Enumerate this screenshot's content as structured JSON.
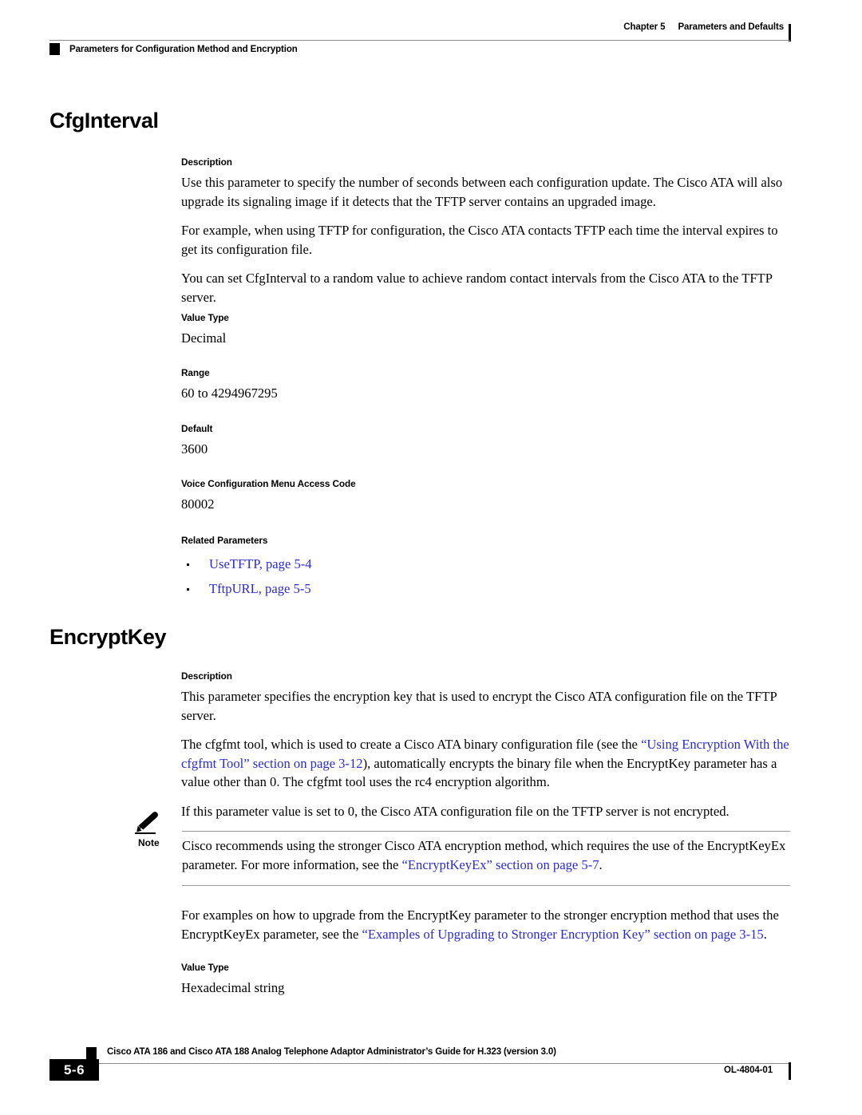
{
  "header": {
    "chapter": "Chapter 5",
    "chapter_title": "Parameters and Defaults",
    "running_head": "Parameters for Configuration Method and Encryption"
  },
  "sections": [
    {
      "title": "CfgInterval",
      "description_label": "Description",
      "description_paragraphs": [
        "Use this parameter to specify the number of seconds between each configuration update. The Cisco ATA will also upgrade its signaling image if it detects that the TFTP server contains an upgraded image.",
        "For example, when using TFTP for configuration, the Cisco ATA contacts TFTP each time the interval expires to get its configuration file.",
        "You can set CfgInterval to a random value to achieve random contact intervals from the Cisco ATA to the TFTP server."
      ],
      "value_type_label": "Value Type",
      "value_type": "Decimal",
      "range_label": "Range",
      "range": "60 to 4294967295",
      "default_label": "Default",
      "default": "3600",
      "access_code_label": "Voice Configuration Menu Access Code",
      "access_code": "80002",
      "related_label": "Related Parameters",
      "related": [
        "UseTFTP, page 5-4",
        "TftpURL, page 5-5"
      ]
    },
    {
      "title": "EncryptKey",
      "description_label": "Description",
      "para1": "This parameter specifies the encryption key that is used to encrypt the Cisco ATA configuration file on the TFTP server.",
      "para2_pre": "The cfgfmt tool, which is used to create a Cisco ATA binary configuration file (see the ",
      "para2_link": "“Using Encryption With the cfgfmt Tool” section on page 3-12",
      "para2_post": "), automatically encrypts the binary file when the EncryptKey parameter has a value other than 0. The cfgfmt tool uses the rc4 encryption algorithm.",
      "para3": "If this parameter value is set to 0, the Cisco ATA configuration file on the TFTP server is not encrypted.",
      "note_word": "Note",
      "note_pre": "Cisco recommends using the stronger Cisco ATA encryption method, which requires the use of the EncryptKeyEx parameter. For more information, see the ",
      "note_link": "“EncryptKeyEx” section on page 5-7",
      "note_post": ".",
      "para4_pre": "For examples on how to upgrade from the EncryptKey parameter to the stronger encryption method that uses the EncryptKeyEx parameter, see the ",
      "para4_link": "“Examples of Upgrading to Stronger Encryption Key” section on page 3-15",
      "para4_post": ".",
      "value_type_label": "Value Type",
      "value_type": "Hexadecimal string"
    }
  ],
  "footer": {
    "guide_title": "Cisco ATA 186 and Cisco ATA 188 Analog Telephone Adaptor Administrator’s Guide for H.323 (version 3.0)",
    "page_number": "5-6",
    "doc_id": "OL-4804-01"
  },
  "colors": {
    "link": "#2b2bd4",
    "rule": "#8a8a8a",
    "text": "#000000"
  }
}
